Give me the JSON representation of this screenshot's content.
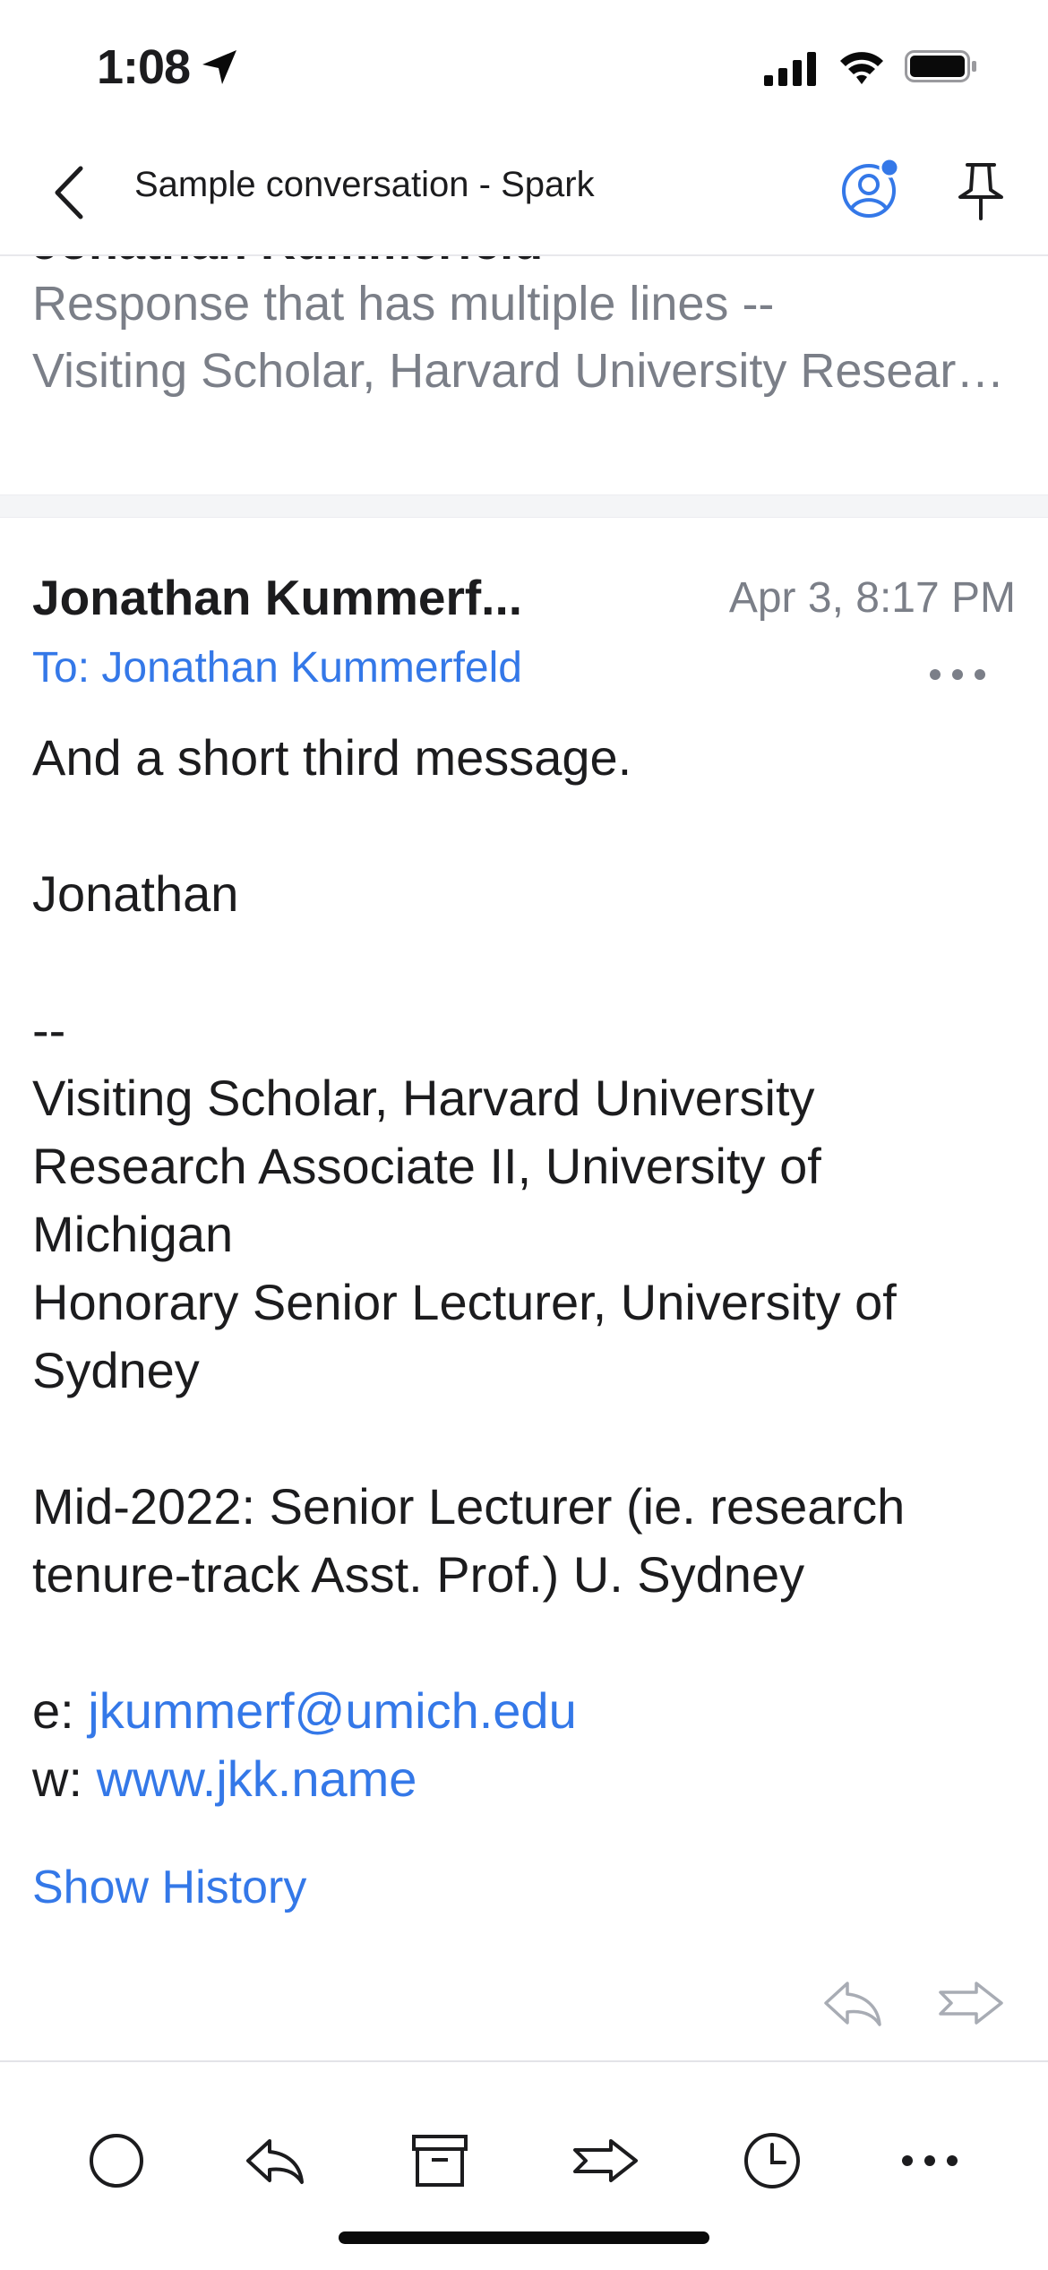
{
  "status_bar": {
    "time": "1:08"
  },
  "nav": {
    "title": "Sample conversation - Spark"
  },
  "previous_message": {
    "sender": "Jonathan Kummerfeld",
    "preview_lines": [
      "Response that has multiple lines --",
      "Visiting Scholar, Harvard University Research Associate II"
    ]
  },
  "message": {
    "sender": "Jonathan Kummerf...",
    "date": "Apr 3, 8:17 PM",
    "recipient": "To: Jonathan Kummerfeld",
    "body": {
      "line1": "And a short third message.",
      "signature_name": "Jonathan",
      "sig_sep": "--",
      "sig1": "Visiting Scholar, Harvard University",
      "sig2": "Research Associate II, University of",
      "sig3": "Michigan",
      "sig4": "Honorary Senior Lecturer, University of",
      "sig5": "Sydney",
      "sig6": "Mid-2022: Senior Lecturer (ie. research",
      "sig7": "tenure-track Asst. Prof.) U. Sydney",
      "email_prefix": "e: ",
      "email": "jkummerf@umich.edu",
      "web_prefix": "w: ",
      "web": "www.jkk.name"
    },
    "show_history": "Show History"
  },
  "colors": {
    "accent": "#3478e8",
    "secondary_text": "#7b7f88",
    "notification_dot": "#3478e8"
  },
  "toolbar": {
    "icons": [
      "mark-unread-icon",
      "reply-icon",
      "archive-icon",
      "forward-icon",
      "snooze-icon",
      "more-icon"
    ]
  }
}
